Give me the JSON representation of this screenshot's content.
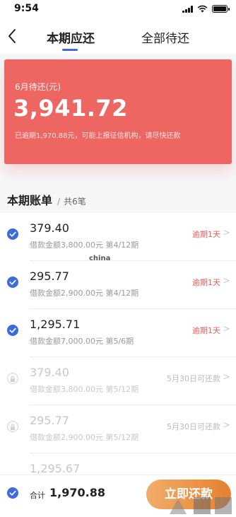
{
  "status_bar": {
    "time": "9:54"
  },
  "nav": {
    "tab_current": "本期应还",
    "tab_all": "全部待还"
  },
  "hero": {
    "label": "6月待还(元)",
    "amount": "3,941.72",
    "note": "已逾期1,970.88元，可能上报征信机构，请尽快还款"
  },
  "section": {
    "title": "本期账单",
    "separator": "/",
    "count": "共6笔"
  },
  "bills": [
    {
      "amount": "379.40",
      "detail": "借款金额3,800.00元 第4/12期",
      "status": "逾期1天",
      "state": "overdue"
    },
    {
      "amount": "295.77",
      "detail": "借款金额2,900.00元 第4/12期",
      "status": "逾期1天",
      "state": "overdue"
    },
    {
      "amount": "1,295.71",
      "detail": "借款金额7,000.00元 第5/6期",
      "status": "逾期1天",
      "state": "overdue"
    },
    {
      "amount": "379.40",
      "detail": "借款金额3,800.00元 第5/12期",
      "status": "5月30日可还款",
      "state": "future"
    },
    {
      "amount": "295.77",
      "detail": "借款金额2,900.00元 第5/12期",
      "status": "5月30日可还款",
      "state": "future"
    },
    {
      "amount": "1,295.67",
      "detail": "",
      "status": "",
      "state": "future"
    }
  ],
  "watermark": "china",
  "footer": {
    "total_label": "合计",
    "total_value": "1,970.88",
    "pay_button": "立即还款"
  },
  "colors": {
    "accent": "#3d6bde",
    "hero": "#ee6662",
    "overdue": "#ee5b57",
    "button": "#e4812f"
  }
}
